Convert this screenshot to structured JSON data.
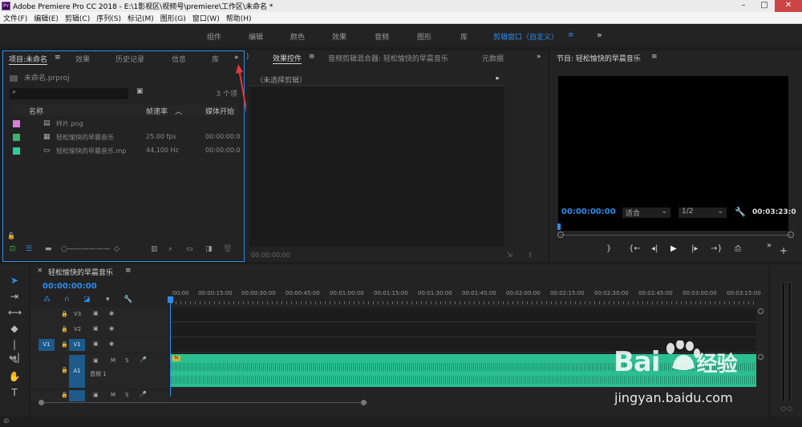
{
  "window": {
    "title": "Adobe Premiere Pro CC 2018 - E:\\1影视区\\视频号\\premiere\\工作区\\未命名 *",
    "app_icon": "Pr",
    "buttons": [
      "minimize-icon",
      "restore-icon",
      "close-icon"
    ]
  },
  "menu": [
    "文件(F)",
    "编辑(E)",
    "剪辑(C)",
    "序列(S)",
    "标记(M)",
    "图形(G)",
    "窗口(W)",
    "帮助(H)"
  ],
  "workspaces": {
    "items": [
      "组件",
      "编辑",
      "颜色",
      "效果",
      "音频",
      "图形",
      "库"
    ],
    "active": "剪辑窗口（自定义）",
    "more": "»"
  },
  "project_panel": {
    "tabs": [
      "项目:未命名",
      "效果",
      "历史记录",
      "信息",
      "库"
    ],
    "more": "»",
    "file": "未命名.prproj",
    "count": "3 个项",
    "columns": [
      "名称",
      "帧速率",
      "媒体开始"
    ],
    "items": [
      {
        "name": "样片.png",
        "fps": "",
        "start": "",
        "color": "#d67fd6",
        "icon": "image-icon"
      },
      {
        "name": "轻松愉快的早晨音乐",
        "fps": "25.00 fps",
        "start": "00:00:00:0",
        "color": "#3cb371",
        "icon": "sequence-icon"
      },
      {
        "name": "轻松愉快的早晨音乐.mp",
        "fps": "44,100 Hz",
        "start": "00:00:00:0",
        "color": "#2ecc9a",
        "icon": "audio-file-icon"
      }
    ]
  },
  "effects_panel": {
    "tabs": [
      "效果控件",
      "音频剪辑混合器: 轻松愉快的早晨音乐",
      "元数据"
    ],
    "more": "»",
    "no_clip": "（未选择剪辑）",
    "timecode": "00:00:00:00"
  },
  "program_monitor": {
    "title": "节目: 轻松愉快的早晨音乐",
    "timecode_left": "00:00:00:00",
    "fit": "适合",
    "resolution": "1/2",
    "duration": "00:03:23:0"
  },
  "timeline": {
    "sequence_name": "轻松愉快的早晨音乐",
    "timecode": "00:00:00:00",
    "ruler": [
      ":00:00",
      "00:00:15:00",
      "00:00:30:00",
      "00:00:45:00",
      "00:01:00:00",
      "00:01:15:00",
      "00:01:30:00",
      "00:01:45:00",
      "00:02:00:00",
      "00:02:15:00",
      "00:02:30:00",
      "00:02:45:00",
      "00:03:00:00",
      "00:03:15:00"
    ],
    "tracks": {
      "v3": "V3",
      "v2": "V2",
      "v1": "V1",
      "v1_src": "V1",
      "a1": "A1",
      "a1_name": "音频 1",
      "m": "M",
      "s": "S"
    }
  },
  "watermark": {
    "logo_left": "Bai",
    "logo_right": "经验",
    "url": "jingyan.baidu.com"
  },
  "colors": {
    "accent": "#2d8ceb",
    "audio_clip": "#2bbf8f"
  }
}
